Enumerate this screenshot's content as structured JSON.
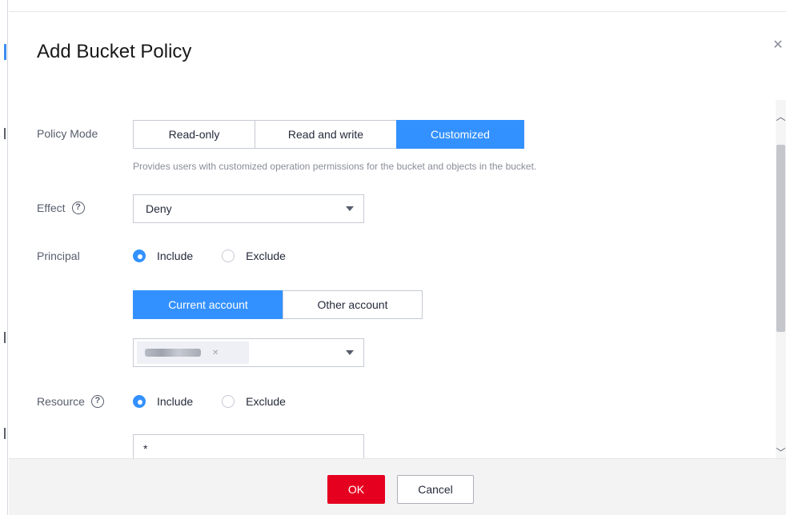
{
  "dialog": {
    "title": "Add Bucket Policy",
    "close_icon": "close-icon"
  },
  "policy_mode": {
    "label": "Policy Mode",
    "options": [
      "Read-only",
      "Read and write",
      "Customized"
    ],
    "selected": "Customized",
    "hint": "Provides users with customized operation permissions for the bucket and objects in the bucket."
  },
  "effect": {
    "label": "Effect",
    "help_icon": "question-circle-icon",
    "value": "Deny"
  },
  "principal": {
    "label": "Principal",
    "include_label": "Include",
    "exclude_label": "Exclude",
    "selected": "Include",
    "account_tabs": [
      "Current account",
      "Other account"
    ],
    "active_account_tab": "Current account",
    "selected_account": "redacted"
  },
  "resource": {
    "label": "Resource",
    "help_icon": "question-circle-icon",
    "include_label": "Include",
    "exclude_label": "Exclude",
    "selected": "Include",
    "value": "*"
  },
  "footer": {
    "ok_label": "OK",
    "cancel_label": "Cancel"
  },
  "colors": {
    "accent": "#3391ff",
    "danger": "#e6001f"
  }
}
